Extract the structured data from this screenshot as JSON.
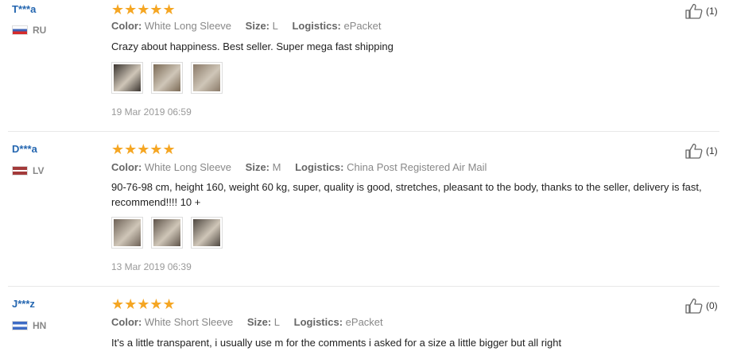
{
  "labels": {
    "color": "Color:",
    "size": "Size:",
    "logistics": "Logistics:",
    "stars": "★★★★★"
  },
  "reviews": [
    {
      "user": "T***a",
      "country": "RU",
      "color": "White Long Sleeve",
      "size": "L",
      "logistics": "ePacket",
      "text": "Crazy about happiness. Best seller. Super mega fast shipping",
      "date": "19 Mar 2019 06:59",
      "likes": "(1)",
      "thumb_colors": [
        "#3b3530",
        "#7b6a55",
        "#8a7a68"
      ]
    },
    {
      "user": "D***a",
      "country": "LV",
      "color": "White Long Sleeve",
      "size": "M",
      "logistics": "China Post Registered Air Mail",
      "text": "90-76-98 cm, height 160, weight 60 kg, super, quality is good, stretches, pleasant to the body, thanks to the seller, delivery is fast, recommend!!!! 10 +",
      "date": "13 Mar 2019 06:39",
      "likes": "(1)",
      "thumb_colors": [
        "#6e6257",
        "#5f544a",
        "#4e4740"
      ]
    },
    {
      "user": "J***z",
      "country": "HN",
      "color": "White Short Sleeve",
      "size": "L",
      "logistics": "ePacket",
      "text": "It's a little transparent, i usually use m for the comments i asked for a size a little bigger but all right",
      "likes": "(0)"
    }
  ]
}
